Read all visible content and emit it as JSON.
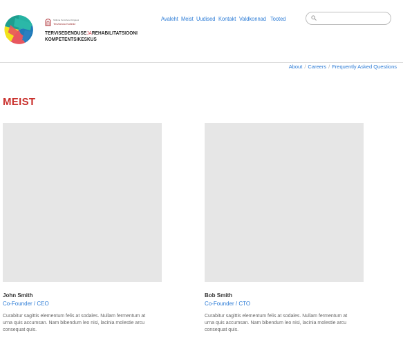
{
  "header": {
    "logo_alt": "Tervisedenduse ja rehabilitatsiooni kompetentsikeskus logo",
    "university_line1": "Tallinna Tervishoiu Kõrgkool",
    "university_line2": "Tervishoiu Kolledž",
    "org_name_part1": "TERVISEDENDUSE",
    "org_name_ja": "JA",
    "org_name_part2": "REHABILITATSIOONI",
    "org_name_line2": "KOMPETENTSIKESKUS",
    "nav": [
      "Avaleht",
      "Meist",
      "Uudised",
      "Kontakt",
      "Valdkonnad",
      "Tooted"
    ],
    "search": {
      "value": "",
      "placeholder": ""
    }
  },
  "breadcrumb": {
    "items": [
      "About",
      "Careers",
      "Frequently Asked Questions"
    ],
    "separator": "/"
  },
  "page_title": "MEIST",
  "team": [
    {
      "name": "John Smith",
      "role": "Co-Founder / CEO",
      "bio": "Curabitur sagittis elementum felis at sodales. Nullam fermentum at urna quis accumsan. Nam bibendum leo nisi, lacinia molestie arcu consequat quis."
    },
    {
      "name": "Bob Smith",
      "role": "Co-Founder / CTO",
      "bio": "Curabitur sagittis elementum felis at sodales. Nullam fermentum at urna quis accumsan. Nam bibendum leo nisi, lacinia molestie arcu consequat quis."
    }
  ],
  "colors": {
    "accent_link": "#2b7bd6",
    "title_red": "#c9302c",
    "photo_placeholder": "#e6e6e6"
  },
  "icons": {
    "search": "search-icon",
    "logo": "colorful-circle-logo-icon"
  }
}
